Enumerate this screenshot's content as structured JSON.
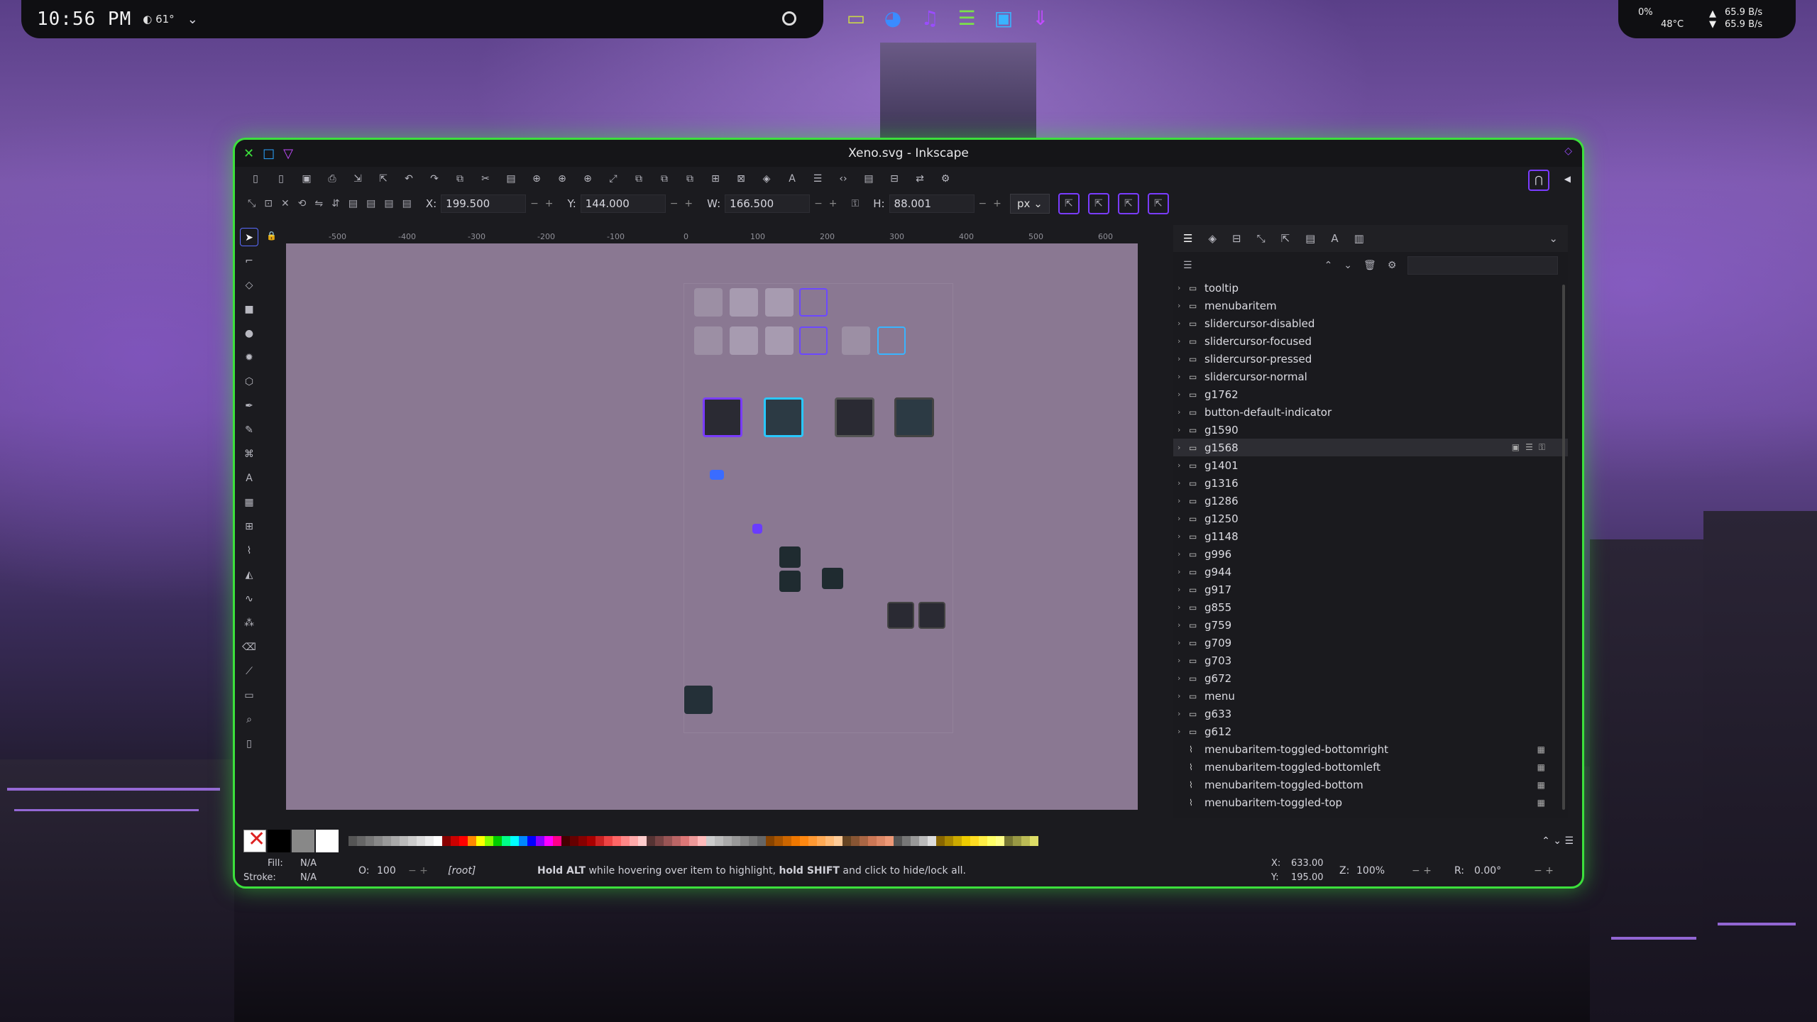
{
  "topbar": {
    "clock": "10:56 PM",
    "weather": "61°",
    "net_cpu": "0%",
    "temp": "48°C",
    "net_up": "65.9 B/s",
    "net_down": "65.9 B/s"
  },
  "dock": [
    "folder-icon",
    "browser-icon",
    "music-icon",
    "notes-icon",
    "media-icon",
    "download-icon"
  ],
  "window": {
    "title": "Xeno.svg - Inkscape"
  },
  "controls": {
    "x_label": "X:",
    "x_value": "199.500",
    "y_label": "Y:",
    "y_value": "144.000",
    "w_label": "W:",
    "w_value": "166.500",
    "h_label": "H:",
    "h_value": "88.001",
    "unit": "px"
  },
  "ruler": {
    "h_ticks": [
      "-500",
      "-400",
      "-300",
      "-200",
      "-100",
      "0",
      "100",
      "200",
      "300",
      "400",
      "500",
      "600"
    ]
  },
  "layers": [
    {
      "name": "tooltip",
      "type": "group"
    },
    {
      "name": "menubaritem",
      "type": "group"
    },
    {
      "name": "slidercursor-disabled",
      "type": "group"
    },
    {
      "name": "slidercursor-focused",
      "type": "group"
    },
    {
      "name": "slidercursor-pressed",
      "type": "group"
    },
    {
      "name": "slidercursor-normal",
      "type": "group"
    },
    {
      "name": "g1762",
      "type": "group"
    },
    {
      "name": "button-default-indicator",
      "type": "group"
    },
    {
      "name": "g1590",
      "type": "group"
    },
    {
      "name": "g1568",
      "type": "group",
      "selected": true
    },
    {
      "name": "g1401",
      "type": "group"
    },
    {
      "name": "g1316",
      "type": "group"
    },
    {
      "name": "g1286",
      "type": "group"
    },
    {
      "name": "g1250",
      "type": "group"
    },
    {
      "name": "g1148",
      "type": "group"
    },
    {
      "name": "g996",
      "type": "group"
    },
    {
      "name": "g944",
      "type": "group"
    },
    {
      "name": "g917",
      "type": "group"
    },
    {
      "name": "g855",
      "type": "group"
    },
    {
      "name": "g759",
      "type": "group"
    },
    {
      "name": "g709",
      "type": "group"
    },
    {
      "name": "g703",
      "type": "group"
    },
    {
      "name": "g672",
      "type": "group"
    },
    {
      "name": "menu",
      "type": "group"
    },
    {
      "name": "g633",
      "type": "group"
    },
    {
      "name": "g612",
      "type": "group"
    },
    {
      "name": "menubaritem-toggled-bottomright",
      "type": "path"
    },
    {
      "name": "menubaritem-toggled-bottomleft",
      "type": "path"
    },
    {
      "name": "menubaritem-toggled-bottom",
      "type": "path"
    },
    {
      "name": "menubaritem-toggled-top",
      "type": "path"
    }
  ],
  "status": {
    "fill_label": "Fill:",
    "fill_value": "N/A",
    "stroke_label": "Stroke:",
    "stroke_value": "N/A",
    "opacity_label": "O:",
    "opacity_value": "100",
    "layer": "[root]",
    "message_pre": "Hold ALT",
    "message_mid": " while hovering over item to highlight, ",
    "message_bold": "hold SHIFT",
    "message_post": " and click to hide/lock all.",
    "cursor_x_label": "X:",
    "cursor_x": "633.00",
    "cursor_y_label": "Y:",
    "cursor_y": "195.00",
    "zoom_label": "Z:",
    "zoom": "100%",
    "rotate_label": "R:",
    "rotate": "0.00°"
  },
  "colors": {
    "accent_green": "#3ce03c",
    "accent_purple": "#7a3cff",
    "canvas": "#8a7892"
  }
}
